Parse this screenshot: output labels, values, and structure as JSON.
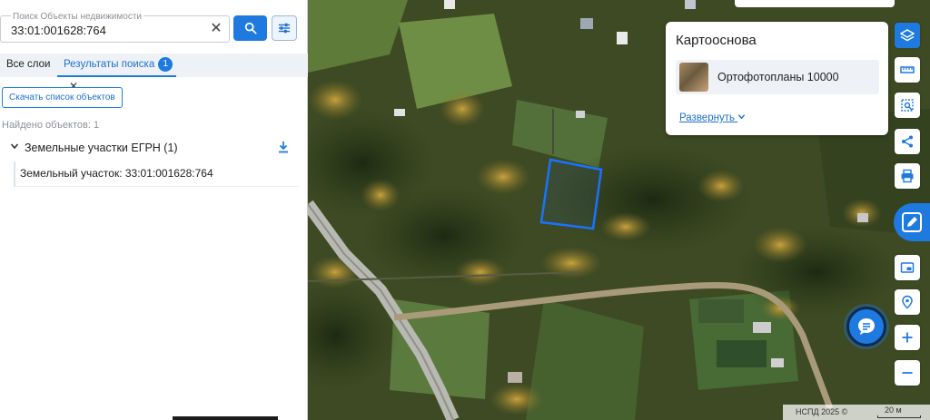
{
  "search": {
    "floating_label": "Поиск Объекты недвижимости",
    "value": "33:01:001628:764",
    "clear_glyph": "✕"
  },
  "tabs": {
    "all_layers": "Все слои",
    "results": "Результаты поиска",
    "results_count": "1",
    "close_glyph": "✕"
  },
  "results": {
    "download_list_button": "Скачать список объектов",
    "found_text": "Найдено объектов: 1",
    "group_label": "Земельные участки ЕГРН (1)",
    "items": [
      "Земельный участок: 33:01:001628:764"
    ]
  },
  "basemap": {
    "title": "Картооснова",
    "selected": "Ортофотопланы 10000",
    "expand": "Развернуть"
  },
  "map": {
    "attribution": "НСПД 2025 ©",
    "scale": "20 м"
  },
  "colors": {
    "accent": "#1f7ae0",
    "parcel_outline": "#1a73ff"
  },
  "icons": {
    "search": "search-icon",
    "filter": "sliders-icon",
    "layers": "layers-icon",
    "ruler": "ruler-icon",
    "select": "select-area-icon",
    "share": "share-icon",
    "print": "printer-icon",
    "pencil": "pencil-icon",
    "picture": "picture-in-picture-icon",
    "location": "location-icon",
    "zoom_in": "plus-icon",
    "zoom_out": "minus-icon",
    "chat": "chat-icon"
  }
}
